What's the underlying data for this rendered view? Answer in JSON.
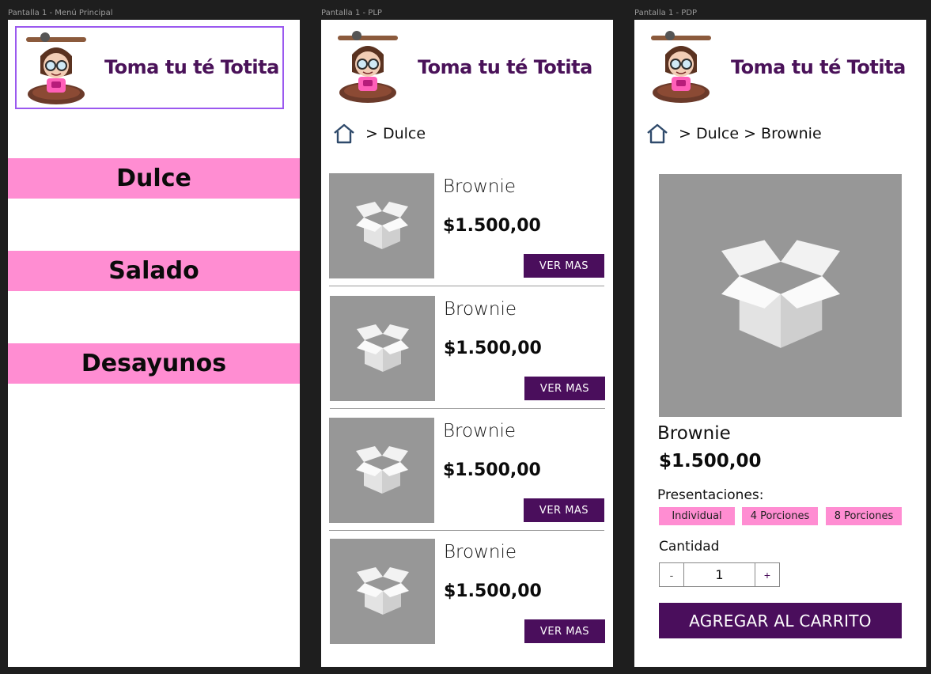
{
  "frames": {
    "menu_label": "Pantalla 1 - Menú Principal",
    "plp_label": "Pantalla 1 - PLP",
    "pdp_label": "Pantalla 1 - PDP"
  },
  "brand": {
    "name": "Toma tu té Totita",
    "accent": "#4a1259"
  },
  "colors": {
    "pink": "#ff8dd2",
    "purple": "#4a0e5c",
    "placeholder_gray": "#979797",
    "selection": "#9b59ef"
  },
  "menu": {
    "categories": [
      "Dulce",
      "Salado",
      "Desayunos"
    ]
  },
  "plp": {
    "breadcrumb": "> Dulce",
    "products": [
      {
        "name": "Brownie",
        "price": "$1.500,00",
        "cta": "VER MAS"
      },
      {
        "name": "Brownie",
        "price": "$1.500,00",
        "cta": "VER MAS"
      },
      {
        "name": "Brownie",
        "price": "$1.500,00",
        "cta": "VER MAS"
      },
      {
        "name": "Brownie",
        "price": "$1.500,00",
        "cta": "VER MAS"
      }
    ]
  },
  "pdp": {
    "breadcrumb": "> Dulce > Brownie",
    "name": "Brownie",
    "price": "$1.500,00",
    "presentations_label": "Presentaciones:",
    "presentations": [
      "Individual",
      "4 Porciones",
      "8 Porciones"
    ],
    "quantity_label": "Cantidad",
    "quantity": "1",
    "minus": "-",
    "plus": "+",
    "add_to_cart": "AGREGAR AL CARRITO"
  },
  "icons": {
    "home": "home-icon",
    "product_placeholder": "box-icon",
    "logo": "mascot-logo"
  }
}
